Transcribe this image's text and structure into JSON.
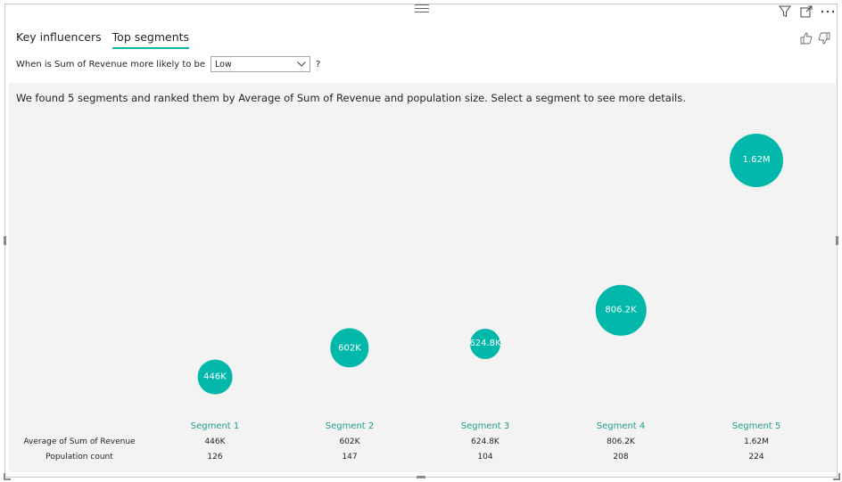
{
  "tabs": [
    {
      "label": "Key influencers",
      "active": false
    },
    {
      "label": "Top segments",
      "active": true
    }
  ],
  "question": {
    "prefix": "When is Sum of Revenue more likely to be",
    "selected": "Low",
    "help": "?"
  },
  "summary": "We found 5 segments and ranked them by Average of Sum of Revenue and population size. Select a segment to see more details.",
  "metrics": {
    "row1_label": "Average of Sum of Revenue",
    "row2_label": "Population count"
  },
  "segments": [
    {
      "name": "Segment 1",
      "bubble_label": "446K",
      "avg_revenue": "446K",
      "population": "126",
      "value": 446000,
      "population_value": 126
    },
    {
      "name": "Segment 2",
      "bubble_label": "602K",
      "avg_revenue": "602K",
      "population": "147",
      "value": 602000,
      "population_value": 147
    },
    {
      "name": "Segment 3",
      "bubble_label": "624.8K",
      "avg_revenue": "624.8K",
      "population": "104",
      "value": 624800,
      "population_value": 104
    },
    {
      "name": "Segment 4",
      "bubble_label": "806.2K",
      "avg_revenue": "806.2K",
      "population": "208",
      "value": 806200,
      "population_value": 208
    },
    {
      "name": "Segment 5",
      "bubble_label": "1.62M",
      "avg_revenue": "1.62M",
      "population": "224",
      "value": 1620000,
      "population_value": 224
    }
  ],
  "colors": {
    "accent": "#01b8aa",
    "segment_label": "#1e9d8f",
    "panel_bg": "#f3f3f3"
  },
  "icons": {
    "filter": "filter-icon",
    "focus": "focus-mode-icon",
    "more": "more-options-icon",
    "thumbs_up": "thumbs-up-icon",
    "thumbs_down": "thumbs-down-icon",
    "dropdown": "chevron-down-icon"
  }
}
